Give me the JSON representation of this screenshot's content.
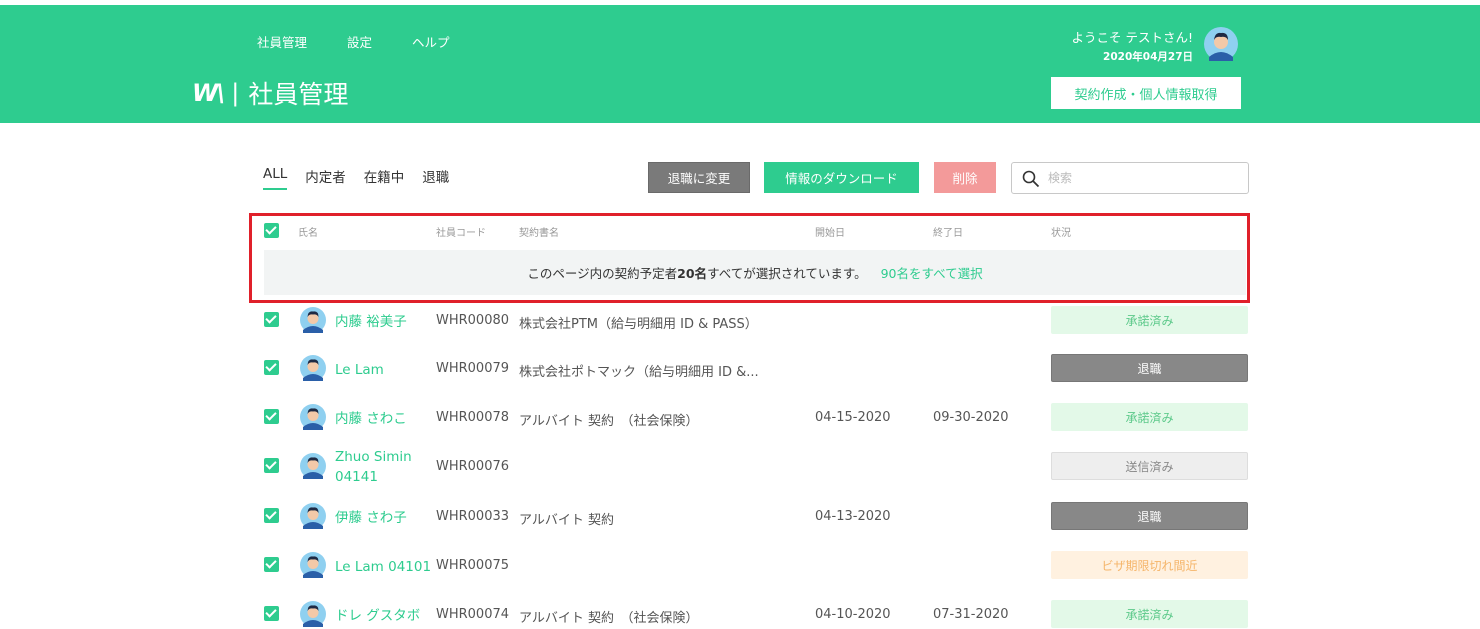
{
  "header": {
    "nav": [
      "社員管理",
      "設定",
      "ヘルプ"
    ],
    "logo_mark": "W\\",
    "logo_sep": "|",
    "page_title": "社員管理",
    "welcome": "ようこそ テストさん!",
    "date": "2020年04月27日",
    "contract_button": "契約作成・個人情報取得"
  },
  "tabs": [
    "ALL",
    "内定者",
    "在籍中",
    "退職"
  ],
  "toolbar": {
    "retire_button": "退職に変更",
    "download_button": "情報のダウンロード",
    "delete_button": "削除",
    "search_placeholder": "検索"
  },
  "columns": {
    "name": "氏名",
    "code": "社員コード",
    "contract": "契約書名",
    "start": "開始日",
    "end": "終了日",
    "status": "状況"
  },
  "banner": {
    "prefix": "このページ内の契約予定者",
    "count": "20名",
    "suffix": "すべてが選択されています。",
    "select_all": "90名をすべて選択"
  },
  "rows": [
    {
      "name": "内藤 裕美子",
      "code": "WHR00080",
      "contract": "株式会社PTM（給与明細用 ID & PASS）",
      "start": "",
      "end": "",
      "status": "承諾済み",
      "status_type": "accepted"
    },
    {
      "name": "Le Lam",
      "code": "WHR00079",
      "contract": "株式会社ポトマック（給与明細用 ID &...",
      "start": "",
      "end": "",
      "status": "退職",
      "status_type": "retired"
    },
    {
      "name": "内藤 さわこ",
      "code": "WHR00078",
      "contract": "アルバイト 契約　（社会保険）",
      "start": "04-15-2020",
      "end": "09-30-2020",
      "status": "承諾済み",
      "status_type": "accepted"
    },
    {
      "name": "Zhuo Simin 04141",
      "code": "WHR00076",
      "contract": "",
      "start": "",
      "end": "",
      "status": "送信済み",
      "status_type": "sent"
    },
    {
      "name": "伊藤 さわ子",
      "code": "WHR00033",
      "contract": "アルバイト 契約",
      "start": "04-13-2020",
      "end": "",
      "status": "退職",
      "status_type": "retired"
    },
    {
      "name": "Le Lam 04101",
      "code": "WHR00075",
      "contract": "",
      "start": "",
      "end": "",
      "status": "ビザ期限切れ間近",
      "status_type": "visa"
    },
    {
      "name": "ドレ グスタボ",
      "code": "WHR00074",
      "contract": "アルバイト 契約　（社会保険）",
      "start": "04-10-2020",
      "end": "07-31-2020",
      "status": "承諾済み",
      "status_type": "accepted"
    }
  ],
  "colors": {
    "brand": "#2ecc8f",
    "highlight": "#e0202a"
  }
}
